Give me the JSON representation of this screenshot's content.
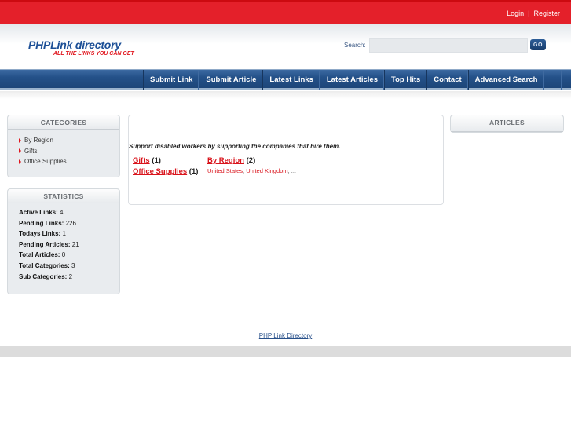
{
  "topbar": {
    "login": "Login",
    "separator": "|",
    "register": "Register"
  },
  "header": {
    "site_name": "PHPLink directory",
    "tagline": "ALL THE LINKS YOU CAN GET",
    "search_label": "Search:",
    "search_value": "",
    "search_placeholder": "",
    "go_label": "GO"
  },
  "nav": {
    "items": [
      {
        "label": "Submit Link"
      },
      {
        "label": "Submit Article"
      },
      {
        "label": "Latest Links"
      },
      {
        "label": "Latest Articles"
      },
      {
        "label": "Top Hits"
      },
      {
        "label": "Contact"
      },
      {
        "label": "Advanced Search"
      }
    ]
  },
  "sidebar": {
    "categories_title": "CATEGORIES",
    "categories": [
      {
        "label": "By Region"
      },
      {
        "label": "Gifts"
      },
      {
        "label": "Office Supplies"
      }
    ],
    "statistics_title": "STATISTICS",
    "statistics": [
      {
        "label": "Active Links:",
        "value": "4"
      },
      {
        "label": "Pending Links:",
        "value": "226"
      },
      {
        "label": "Todays Links:",
        "value": "1"
      },
      {
        "label": "Pending Articles:",
        "value": "21"
      },
      {
        "label": "Total Articles:",
        "value": "0"
      },
      {
        "label": "Total Categories:",
        "value": "3"
      },
      {
        "label": "Sub Categories:",
        "value": "2"
      }
    ]
  },
  "main": {
    "intro": "Support disabled workers by supporting the companies that hire them.",
    "categories": [
      {
        "label": "Gifts",
        "count": "(1)"
      },
      {
        "label": "Office Supplies",
        "count": "(1)"
      },
      {
        "label": "By Region",
        "count": "(2)",
        "subcategories": [
          "United States",
          "United Kingdom"
        ],
        "more": ", ..."
      }
    ]
  },
  "right_sidebar": {
    "articles_title": "ARTICLES"
  },
  "footer": {
    "link": "PHP Link Directory"
  }
}
